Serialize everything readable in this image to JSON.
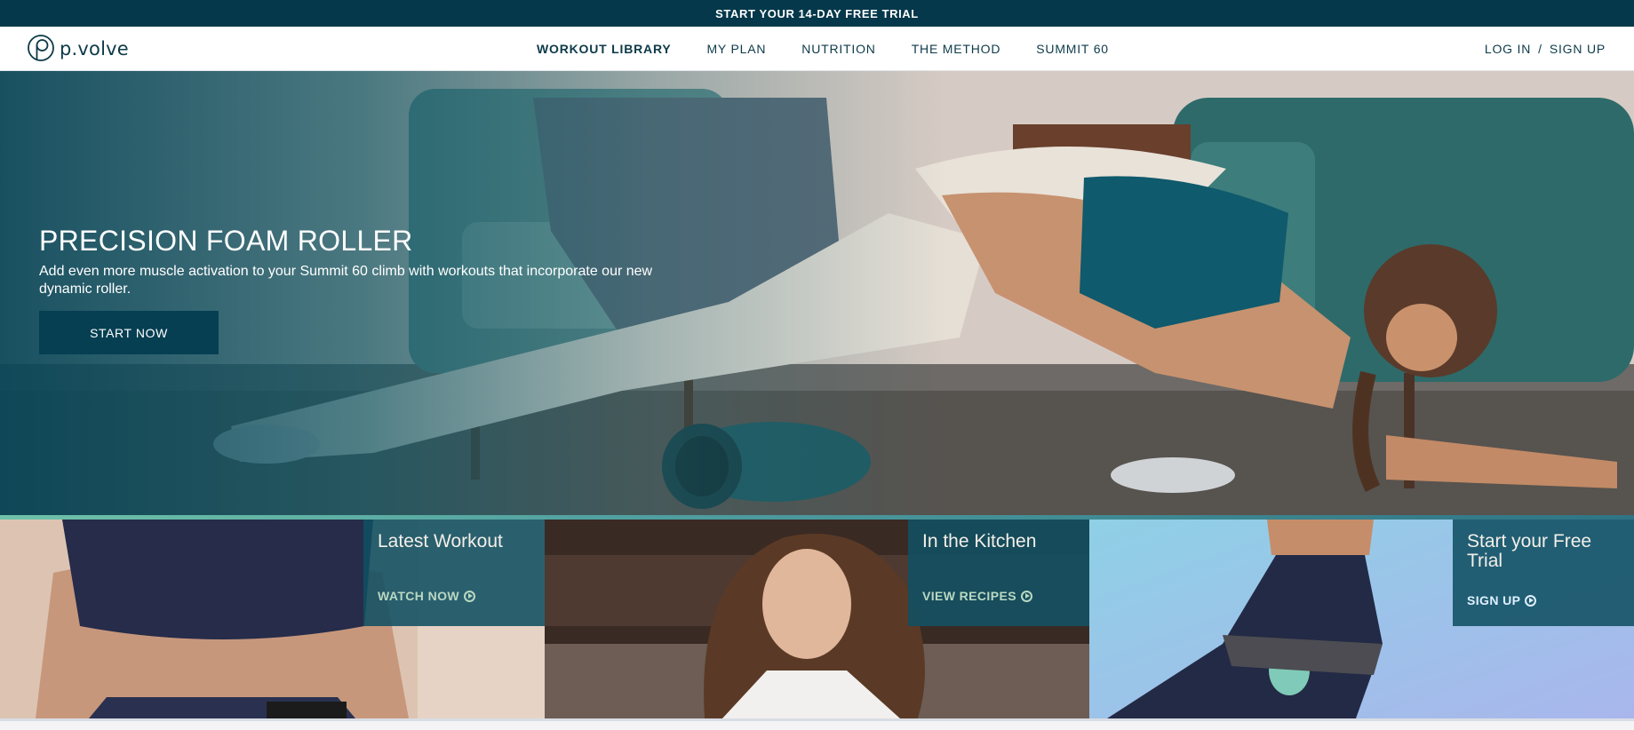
{
  "promo": {
    "text": "START YOUR 14-DAY FREE TRIAL"
  },
  "header": {
    "logo_text": "p.volve",
    "nav": [
      {
        "label": "WORKOUT LIBRARY",
        "active": true
      },
      {
        "label": "MY PLAN"
      },
      {
        "label": "NUTRITION"
      },
      {
        "label": "THE METHOD"
      },
      {
        "label": "SUMMIT 60"
      }
    ],
    "login_label": "LOG IN",
    "separator": "/",
    "signup_label": "SIGN UP"
  },
  "hero": {
    "title": "PRECISION FOAM ROLLER",
    "description": "Add even more muscle activation to your Summit 60 climb with workouts that incorporate our new dynamic roller.",
    "cta_label": "START NOW"
  },
  "tiles": [
    {
      "title": "Latest Workout",
      "link_label": "WATCH NOW"
    },
    {
      "title": "In the Kitchen",
      "link_label": "VIEW RECIPES"
    },
    {
      "title": "Start your Free Trial",
      "link_label": "SIGN UP"
    }
  ],
  "colors": {
    "brand_dark": "#04384a",
    "cta_bg": "#063f52",
    "accent_green": "#6fc2a8",
    "link_mint": "#b9d8c3"
  },
  "icons": [
    "pvolve-logo-icon",
    "play-circle-icon"
  ]
}
